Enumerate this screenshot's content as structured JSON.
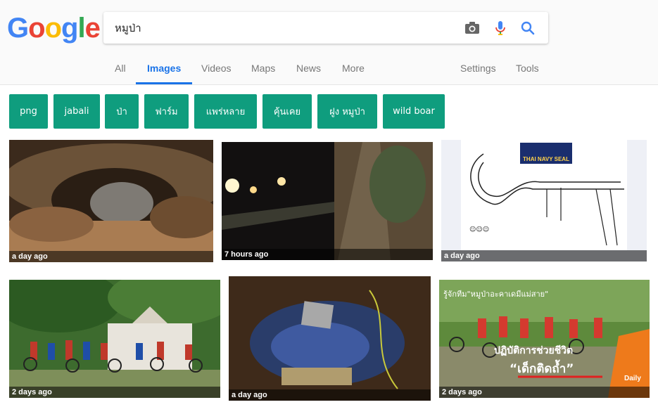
{
  "logo": {
    "text": "Google"
  },
  "search": {
    "query": "หมูป่า"
  },
  "tabs": [
    {
      "label": "All"
    },
    {
      "label": "Images"
    },
    {
      "label": "Videos"
    },
    {
      "label": "Maps"
    },
    {
      "label": "News"
    },
    {
      "label": "More"
    },
    {
      "label": "Settings"
    },
    {
      "label": "Tools"
    }
  ],
  "chips": [
    {
      "label": "png"
    },
    {
      "label": "jabali"
    },
    {
      "label": "ป่า"
    },
    {
      "label": "ฟาร์ม"
    },
    {
      "label": "แพร่หลาย"
    },
    {
      "label": "คุ้นเคย"
    },
    {
      "label": "ฝูง หมูป่า"
    },
    {
      "label": "wild boar"
    }
  ],
  "results": [
    {
      "age": "a day ago"
    },
    {
      "age": "7 hours ago"
    },
    {
      "age": "a day ago",
      "overlay_title": "THAI NAVY SEAL"
    },
    {
      "age": "2 days ago"
    },
    {
      "age": "a day ago"
    },
    {
      "age": "2 days ago",
      "headline": "รู้จักทีม\"หมูป่าอะคาเดมีแม่สาย\"",
      "caption1": "ปฏิบัติการช่วยชีวิต",
      "caption2": "“เด็กติดถ้ำ”",
      "brand": "Daily"
    }
  ],
  "colors": {
    "accent": "#1a73e8",
    "chip": "#0f9d7e"
  }
}
